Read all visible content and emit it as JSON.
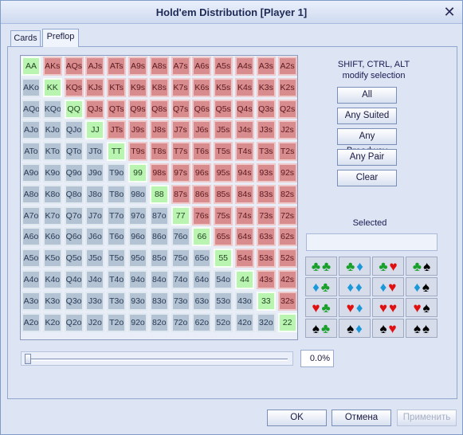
{
  "window": {
    "title": "Hold'em Distribution [Player 1]",
    "close_glyph": "✕"
  },
  "tabs": [
    {
      "label": "Cards"
    },
    {
      "label": "Preflop"
    }
  ],
  "ranks": [
    "A",
    "K",
    "Q",
    "J",
    "T",
    "9",
    "8",
    "7",
    "6",
    "5",
    "4",
    "3",
    "2"
  ],
  "hint": {
    "line1": "SHIFT, CTRL, ALT",
    "line2": "modify selection"
  },
  "buttons": {
    "all": "All",
    "any_suited": "Any Suited",
    "any_broadway": "Any Broadway",
    "any_pair": "Any Pair",
    "clear": "Clear"
  },
  "selected": {
    "label": "Selected",
    "value": ""
  },
  "suit_combos": [
    [
      [
        "club",
        "club"
      ],
      [
        "club",
        "diamond"
      ],
      [
        "club",
        "heart"
      ],
      [
        "club",
        "spade"
      ]
    ],
    [
      [
        "diamond",
        "club"
      ],
      [
        "diamond",
        "diamond"
      ],
      [
        "diamond",
        "heart"
      ],
      [
        "diamond",
        "spade"
      ]
    ],
    [
      [
        "heart",
        "club"
      ],
      [
        "heart",
        "diamond"
      ],
      [
        "heart",
        "heart"
      ],
      [
        "heart",
        "spade"
      ]
    ],
    [
      [
        "spade",
        "club"
      ],
      [
        "spade",
        "diamond"
      ],
      [
        "spade",
        "heart"
      ],
      [
        "spade",
        "spade"
      ]
    ]
  ],
  "slider": {
    "value_percent": 0.0,
    "display": "0.0%"
  },
  "dialog": {
    "ok": "OK",
    "cancel": "Отмена",
    "apply": "Применить"
  },
  "colors": {
    "pair": "#b9f5b0",
    "suited": "#d98c8e",
    "offsuit": "#b3c3d3",
    "club": "#18a02a",
    "diamond": "#1b98d9",
    "heart": "#e01010",
    "spade": "#000000"
  }
}
